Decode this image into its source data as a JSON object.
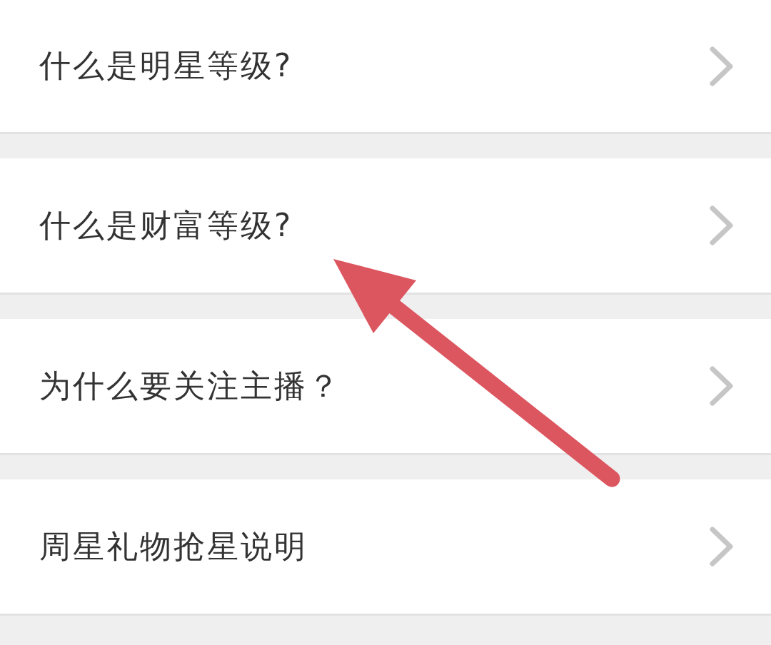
{
  "items": [
    {
      "label": "什么是明星等级?"
    },
    {
      "label": "什么是财富等级?"
    },
    {
      "label": "为什么要关注主播？"
    },
    {
      "label": "周星礼物抢星说明"
    }
  ],
  "annotation": {
    "kind": "arrow"
  }
}
